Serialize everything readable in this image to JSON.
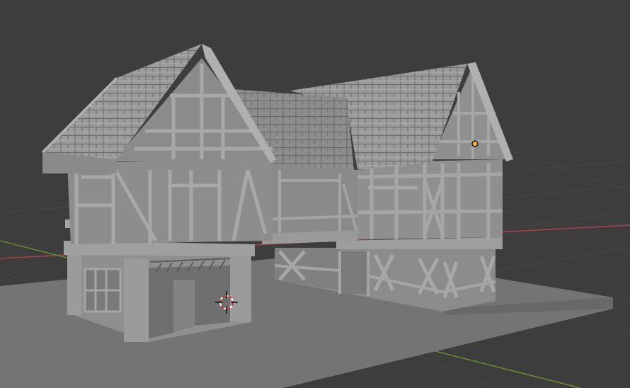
{
  "viewport": {
    "background_color": "#3d3d3d",
    "grid_color": "#474747",
    "x_axis_color": "#a3454f",
    "y_axis_color": "#6b8c2c"
  },
  "scene": {
    "ground_color": "#747474",
    "wall_color": "#8f8f8f",
    "timber_color": "#a3a3a3",
    "roof_color": "#9a9a9a",
    "shadow_color": "#626262",
    "origin_dot_color": "#f2a83a"
  },
  "icons": {
    "cursor": "3d-cursor-icon",
    "origin": "object-origin-icon"
  }
}
